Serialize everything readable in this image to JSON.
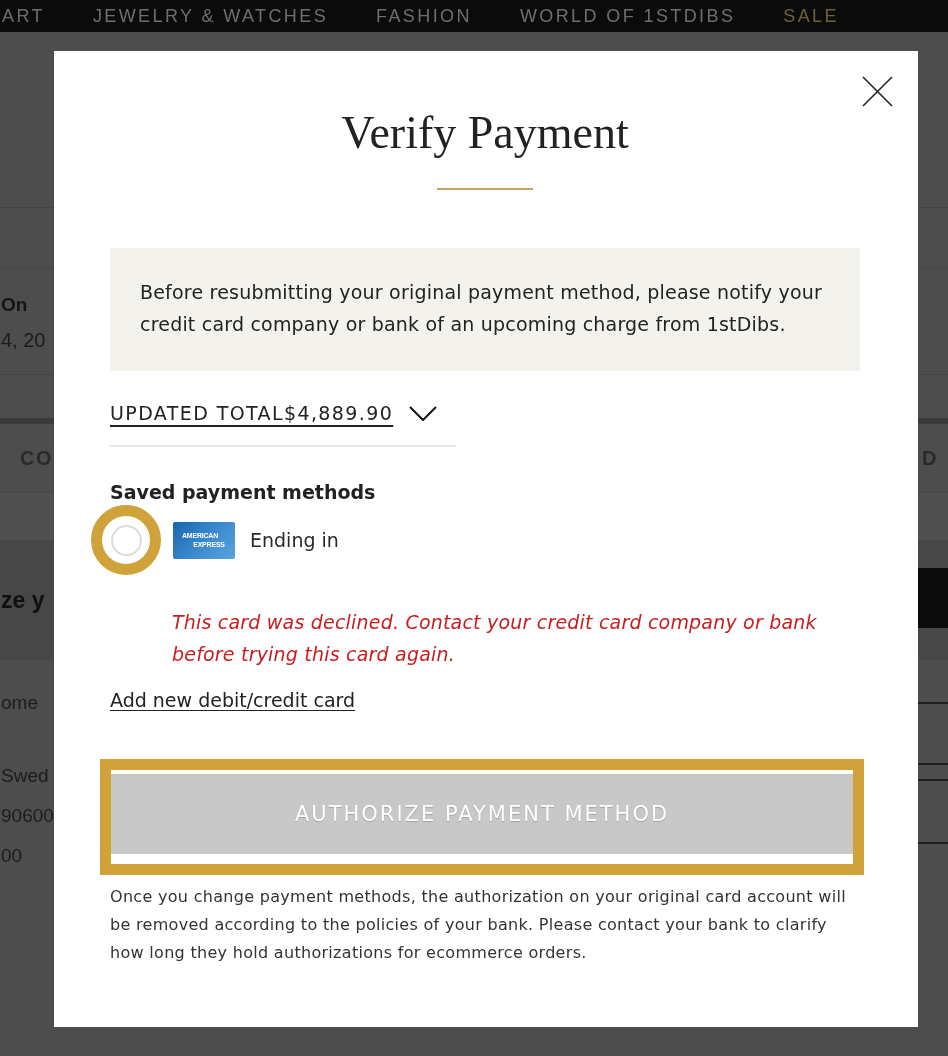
{
  "site_nav": [
    {
      "label": "ART",
      "kind": "category"
    },
    {
      "label": "JEWELRY & WATCHES",
      "kind": "category"
    },
    {
      "label": "FASHION",
      "kind": "category"
    },
    {
      "label": "WORLD OF 1STDIBS",
      "kind": "category"
    },
    {
      "label": "SALE",
      "kind": "sale"
    }
  ],
  "background_page": {
    "section_1": {
      "heading": "On",
      "text": "4, 20"
    },
    "tab_row": {
      "left": "CO",
      "right": "D"
    },
    "banner": {
      "heading": "ze y"
    },
    "section_2": {
      "heading": "ome",
      "lines": [
        "Swed",
        "90600",
        "00"
      ]
    }
  },
  "modal": {
    "title": "Verify Payment",
    "notice": "Before resubmitting your original payment method, please notify your credit card company or bank of an upcoming charge from 1stDibs.",
    "total": {
      "label": "UPDATED TOTAL$4,889.90",
      "expanded": false
    },
    "saved_methods": {
      "heading": "Saved payment methods",
      "items": [
        {
          "brand_text": [
            "AMERICAN",
            "EXPRESS"
          ],
          "label": "Ending in",
          "selected": false,
          "highlighted": true,
          "error": "This card was declined. Contact your credit card company or bank before trying this card again."
        }
      ]
    },
    "add_card_link": "Add new debit/credit card",
    "submit": {
      "label": "AUTHORIZE PAYMENT METHOD",
      "disabled": true,
      "highlighted": true
    },
    "footnote": "Once you change payment methods, the authorization on your original card account will be removed according to the policies of your bank. Please contact your bank to clarify how long they hold authorizations for ecommerce orders."
  }
}
